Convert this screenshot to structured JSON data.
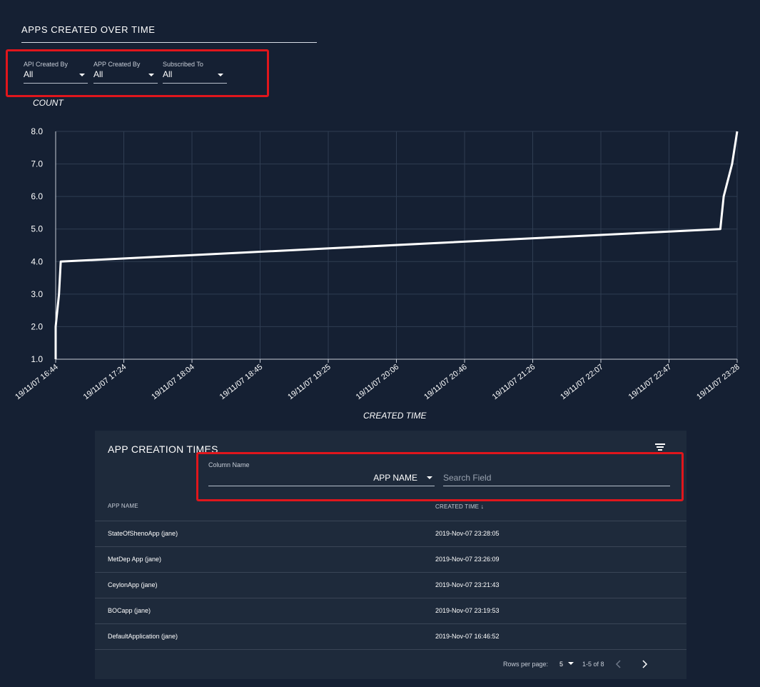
{
  "chart_title": "APPS CREATED OVER TIME",
  "filters": [
    {
      "label": "API Created By",
      "value": "All"
    },
    {
      "label": "APP Created By",
      "value": "All"
    },
    {
      "label": "Subscribed To",
      "value": "All"
    }
  ],
  "colors": {
    "background": "#152033",
    "panel": "#1e2a3b",
    "highlight": "#e0161c",
    "line": "#ffffff",
    "grid": "#2f3d52"
  },
  "chart_data": {
    "type": "line",
    "ylabel": "COUNT",
    "xlabel": "CREATED TIME",
    "ylim": [
      1.0,
      8.0
    ],
    "yticks": [
      "1.0",
      "2.0",
      "3.0",
      "4.0",
      "5.0",
      "6.0",
      "7.0",
      "8.0"
    ],
    "xticks": [
      "19/11/07 16:44",
      "19/11/07 17:24",
      "19/11/07 18:04",
      "19/11/07 18:45",
      "19/11/07 19:25",
      "19/11/07 20:06",
      "19/11/07 20:46",
      "19/11/07 21:26",
      "19/11/07 22:07",
      "19/11/07 22:47",
      "19/11/07 23:28"
    ],
    "x_range": [
      "19/11/07 16:44",
      "19/11/07 23:28"
    ],
    "grid": true,
    "series": [
      {
        "points": [
          {
            "x": "19/11/07 16:44",
            "y": 1
          },
          {
            "x": "19/11/07 16:44",
            "y": 2
          },
          {
            "x": "19/11/07 16:46",
            "y": 3
          },
          {
            "x": "19/11/07 16:47",
            "y": 4
          },
          {
            "x": "19/11/07 23:18",
            "y": 5
          },
          {
            "x": "19/11/07 23:20",
            "y": 6
          },
          {
            "x": "19/11/07 23:25",
            "y": 7
          },
          {
            "x": "19/11/07 23:28",
            "y": 8
          }
        ]
      }
    ]
  },
  "table": {
    "title": "APP CREATION TIMES",
    "column_name_label": "Column Name",
    "column_name_value": "APP NAME",
    "search_placeholder": "Search Field",
    "headers": [
      "APP NAME",
      "CREATED TIME"
    ],
    "rows": [
      {
        "name": "StateOfShenoApp (jane)",
        "time": "2019-Nov-07 23:28:05"
      },
      {
        "name": "MetDep App (jane)",
        "time": "2019-Nov-07 23:26:09"
      },
      {
        "name": "CeylonApp (jane)",
        "time": "2019-Nov-07 23:21:43"
      },
      {
        "name": "BOCapp (jane)",
        "time": "2019-Nov-07 23:19:53"
      },
      {
        "name": "DefaultApplication (jane)",
        "time": "2019-Nov-07 16:46:52"
      }
    ],
    "rows_per_page_label": "Rows per page:",
    "rows_per_page_value": "5",
    "range_text": "1-5 of 8",
    "sort_icon": "arrow-down-icon",
    "prev_icon": "chevron-left-icon",
    "next_icon": "chevron-right-icon",
    "menu_icon": "filter-list-icon"
  }
}
